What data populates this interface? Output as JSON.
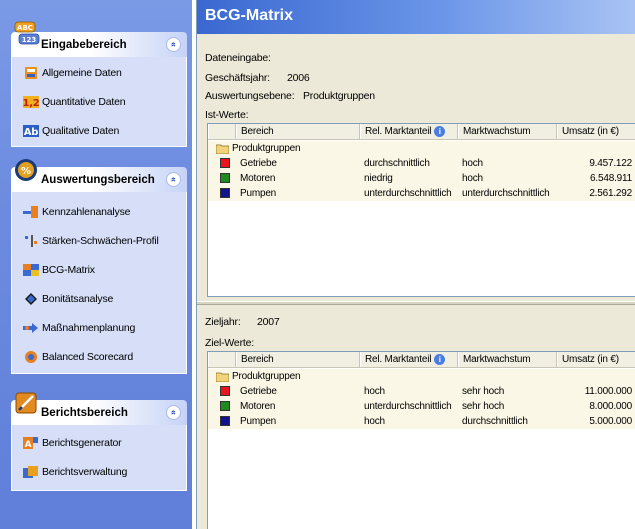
{
  "sidebar": {
    "groups": [
      {
        "title": "Eingabebereich",
        "icon": "abc-123-icon",
        "items": [
          {
            "label": "Allgemeine Daten",
            "icon": "general-data-icon"
          },
          {
            "label": "Quantitative Daten",
            "icon": "quantitative-icon"
          },
          {
            "label": "Qualitative Daten",
            "icon": "qualitative-icon"
          }
        ]
      },
      {
        "title": "Auswertungsbereich",
        "icon": "analysis-icon",
        "items": [
          {
            "label": "Kennzahlenanalyse",
            "icon": "kpi-icon"
          },
          {
            "label": "Stärken-Schwächen-Profil",
            "icon": "profile-icon"
          },
          {
            "label": "BCG-Matrix",
            "icon": "bcg-matrix-icon"
          },
          {
            "label": "Bonitätsanalyse",
            "icon": "credit-analysis-icon"
          },
          {
            "label": "Maßnahmenplanung",
            "icon": "planning-icon"
          },
          {
            "label": "Balanced Scorecard",
            "icon": "scorecard-icon"
          }
        ]
      },
      {
        "title": "Berichtsbereich",
        "icon": "report-icon",
        "items": [
          {
            "label": "Berichtsgenerator",
            "icon": "report-generator-icon"
          },
          {
            "label": "Berichtsverwaltung",
            "icon": "report-management-icon"
          }
        ]
      }
    ],
    "collapse_glyph": "«"
  },
  "main": {
    "title": "BCG-Matrix",
    "input_section": {
      "label": "Dateneingabe:",
      "fiscal_year_label": "Geschäftsjahr:",
      "fiscal_year_value": "2006",
      "level_label": "Auswertungsebene:",
      "level_value": "Produktgruppen",
      "actual_label": "Ist-Werte:"
    },
    "target_section": {
      "target_year_label": "Zieljahr:",
      "target_year_value": "2007",
      "target_label": "Ziel-Werte:"
    },
    "columns": [
      "Bereich",
      "Rel. Marktanteil",
      "Marktwachstum",
      "Umsatz (in €)"
    ],
    "info_glyph": "i",
    "group_label": "Produktgruppen",
    "actual_rows": [
      {
        "name": "Getriebe",
        "color": "#e8141e",
        "share": "durchschnittlich",
        "growth": "hoch",
        "revenue": "9.457.122"
      },
      {
        "name": "Motoren",
        "color": "#1f8a1f",
        "share": "niedrig",
        "growth": "hoch",
        "revenue": "6.548.911"
      },
      {
        "name": "Pumpen",
        "color": "#14148a",
        "share": "unterdurchschnittlich",
        "growth": "unterdurchschnittlich",
        "revenue": "2.561.292"
      }
    ],
    "target_rows": [
      {
        "name": "Getriebe",
        "color": "#e8141e",
        "share": "hoch",
        "growth": "sehr hoch",
        "revenue": "11.000.000"
      },
      {
        "name": "Motoren",
        "color": "#1f8a1f",
        "share": "unterdurchschnittlich",
        "growth": "sehr hoch",
        "revenue": "8.000.000"
      },
      {
        "name": "Pumpen",
        "color": "#14148a",
        "share": "hoch",
        "growth": "durchschnittlich",
        "revenue": "5.000.000"
      }
    ]
  }
}
